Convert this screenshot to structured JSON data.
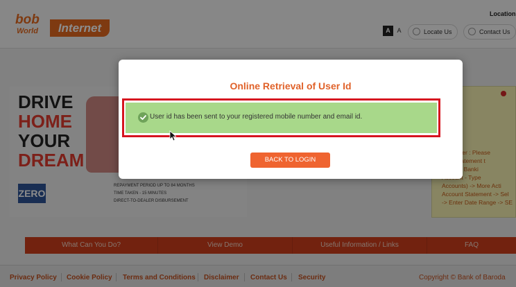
{
  "header": {
    "logo": {
      "bob": "bob",
      "world": "World",
      "internet": "Internet"
    },
    "location_label": "Location",
    "font_size_buttons": [
      "A",
      "A"
    ],
    "locate_us": "Locate Us",
    "contact_us": "Contact Us"
  },
  "banner": {
    "lines": [
      "DRIVE",
      "HOME",
      "YOUR",
      "DREAM"
    ],
    "badge": "ZERO",
    "bullets": [
      "REPAYMENT PERIOD UP TO 84 MONTHS",
      "TIME TAKEN - 15 MINUTES",
      "DIRECT-TO-DEALER DISBURSEMENT"
    ]
  },
  "notice": {
    "lines": [
      "Customer : Please",
      "bank statement t",
      "into Net Banki",
      "Account - Type",
      "Accounts) -> More Acti",
      "Account Statement -> Sel",
      "-> Enter Date Range -> SE"
    ]
  },
  "nav": {
    "items": [
      "What Can You Do?",
      "View Demo",
      "Useful Information / Links",
      "FAQ"
    ]
  },
  "footer": {
    "links": [
      "Privacy Policy",
      "Cookie Policy",
      "Terms and Conditions",
      "Disclaimer",
      "Contact Us",
      "Security"
    ],
    "copyright": "Copyright © Bank of Baroda"
  },
  "modal": {
    "title": "Online Retrieval of User Id",
    "message": "User id has been sent to your registered mobile number and email id.",
    "back_button": "BACK TO LOGIN"
  },
  "colors": {
    "accent": "#e0622a",
    "success": "#a8d88a",
    "highlight": "#d6141f",
    "nav": "#cf3f1c"
  }
}
